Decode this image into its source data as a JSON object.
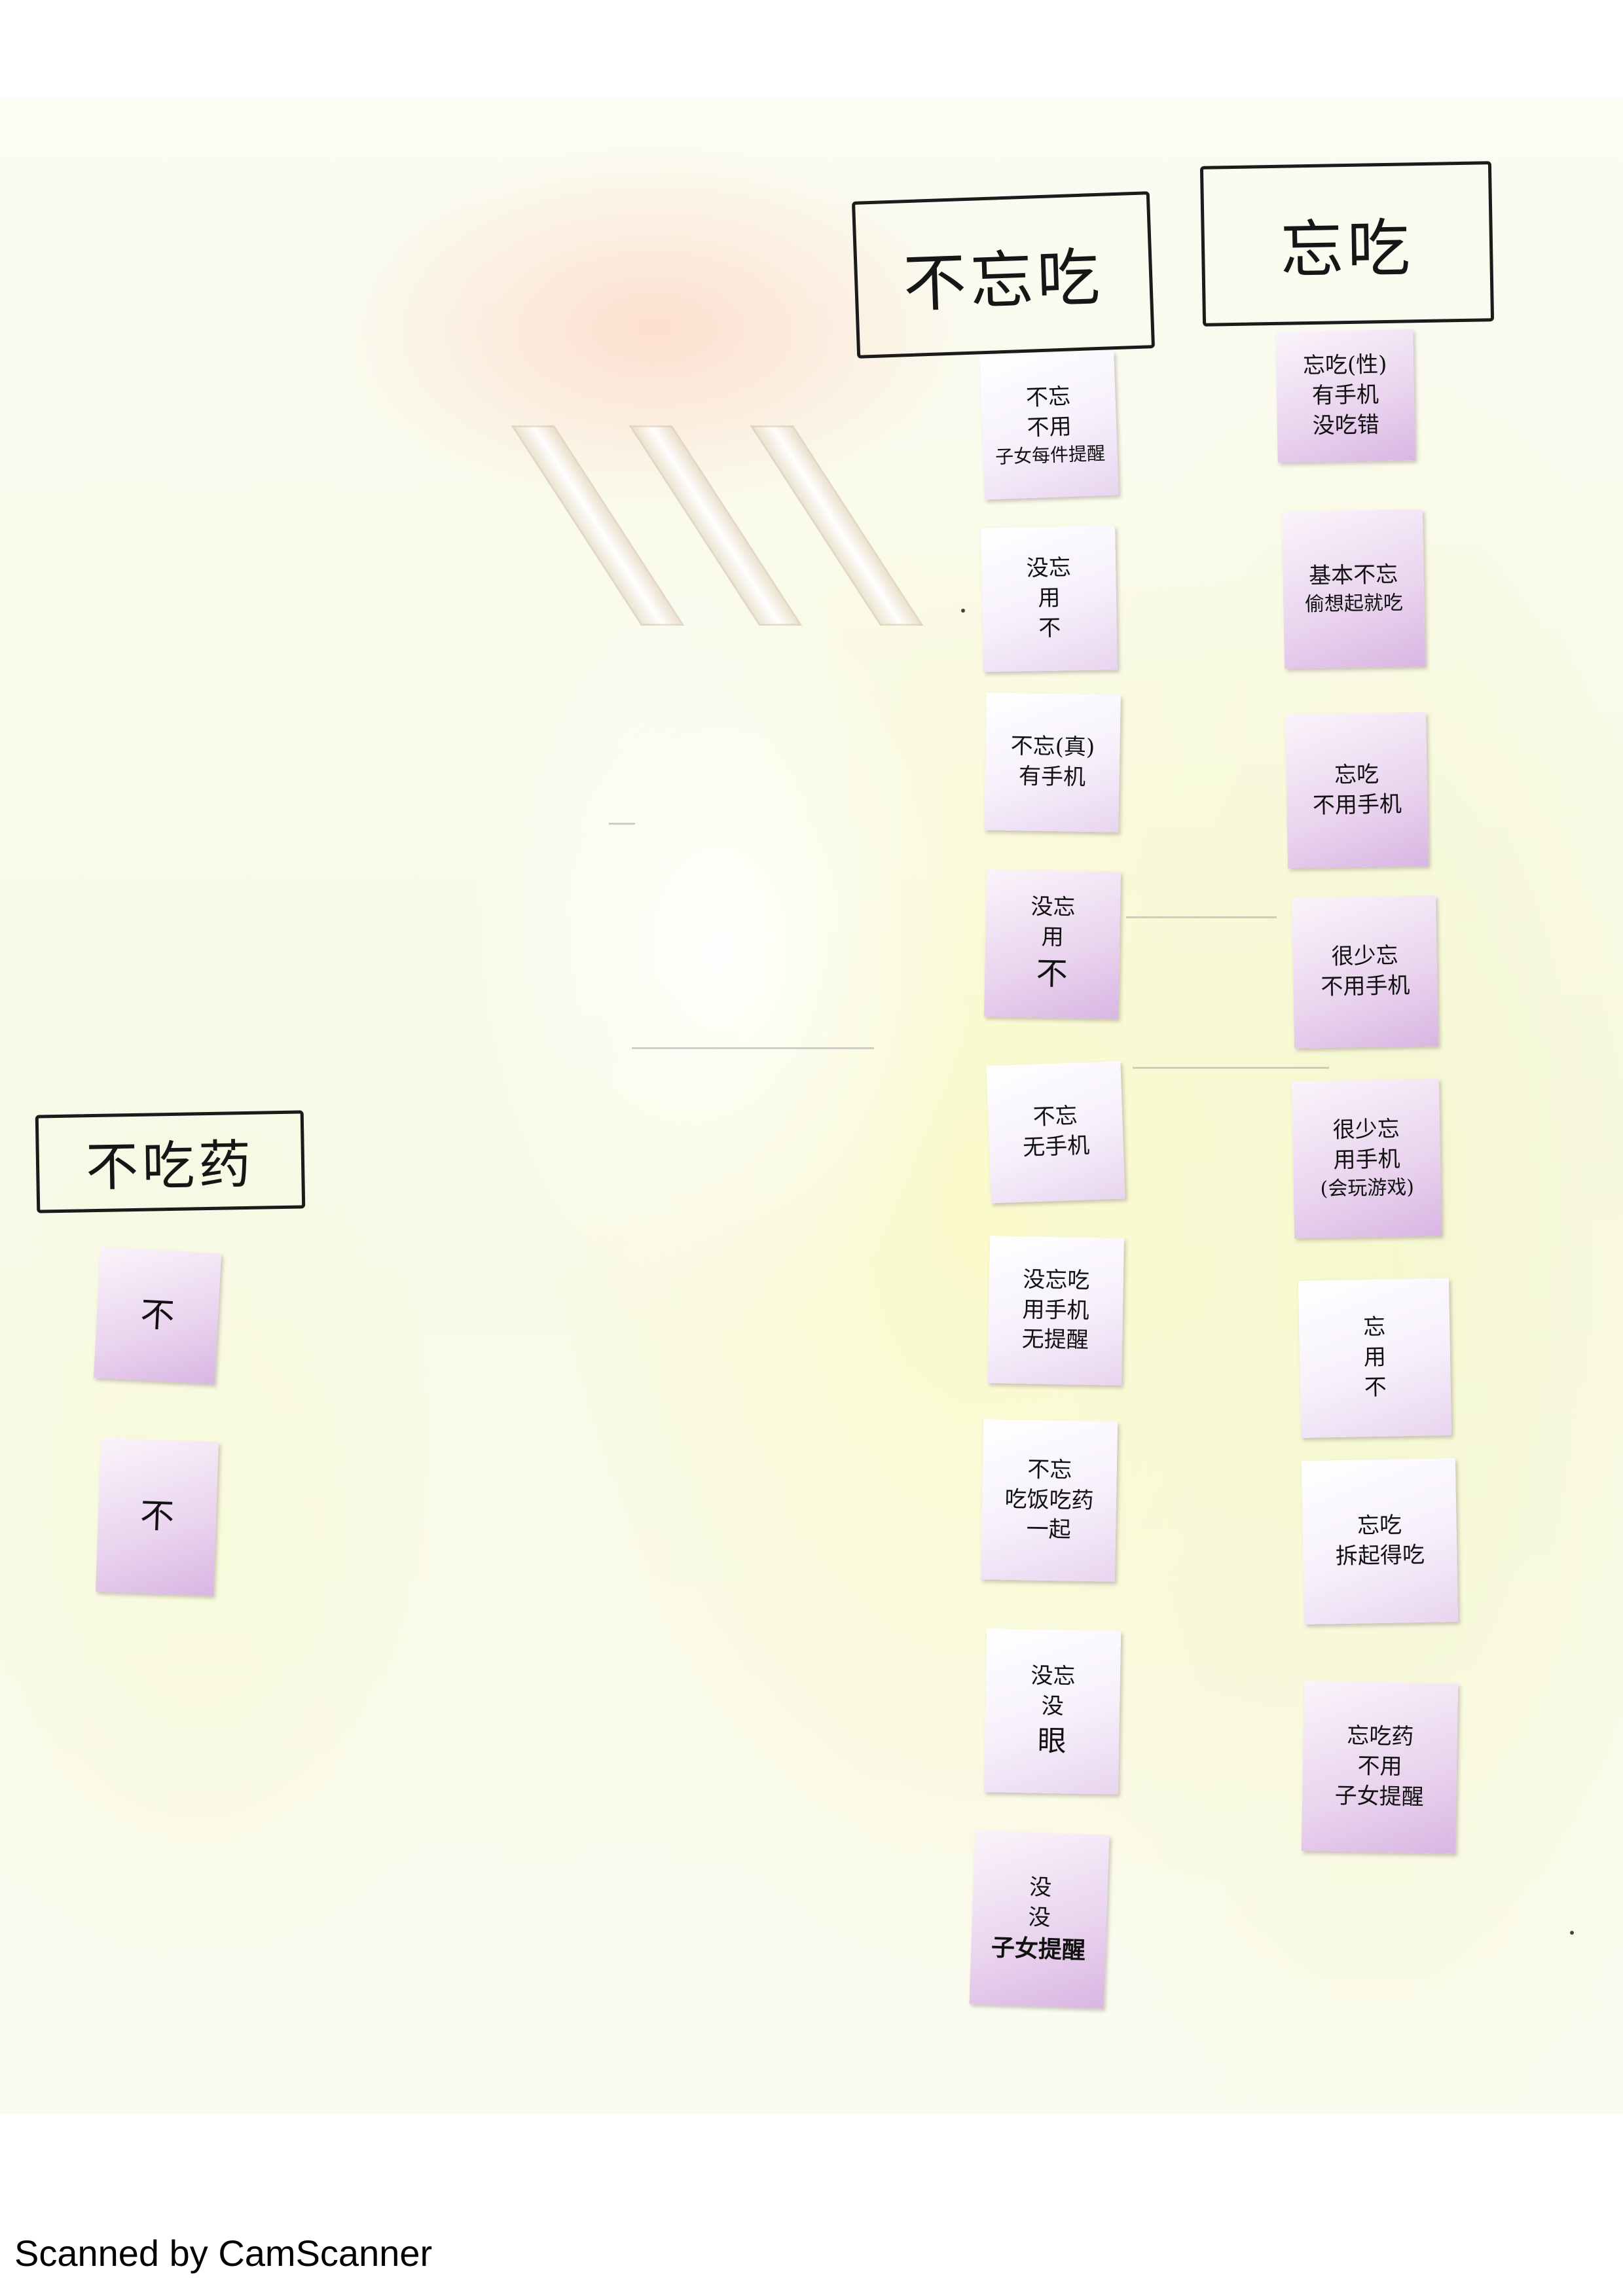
{
  "headers": {
    "no_forget": "不忘吃",
    "forget": "忘吃",
    "no_take": "不吃药"
  },
  "column_no_forget": [
    [
      "不忘",
      "不用",
      "子女每件提醒"
    ],
    [
      "没忘",
      "用",
      "不"
    ],
    [
      "不忘(真)",
      "有手机"
    ],
    [
      "没忘",
      "用",
      "不"
    ],
    [
      "不忘",
      "无手机"
    ],
    [
      "没忘吃",
      "用手机",
      "无提醒"
    ],
    [
      "不忘",
      "吃饭吃药",
      "一起"
    ],
    [
      "没忘",
      "没",
      "眼"
    ],
    [
      "没",
      "没",
      "子女提醒"
    ]
  ],
  "column_forget": [
    [
      "忘吃(性)",
      "有手机",
      "没吃错"
    ],
    [
      "基本不忘",
      "偷想起就吃"
    ],
    [
      "忘吃",
      "不用手机"
    ],
    [
      "很少忘",
      "不用手机"
    ],
    [
      "很少忘",
      "用手机",
      "(会玩游戏)"
    ],
    [
      "忘",
      "用",
      "不"
    ],
    [
      "忘吃",
      "拆起得吃"
    ],
    [
      "忘吃药",
      "不用",
      "子女提醒"
    ]
  ],
  "column_no_take": [
    [
      "不"
    ],
    [
      "不"
    ]
  ],
  "footer": "Scanned by CamScanner"
}
